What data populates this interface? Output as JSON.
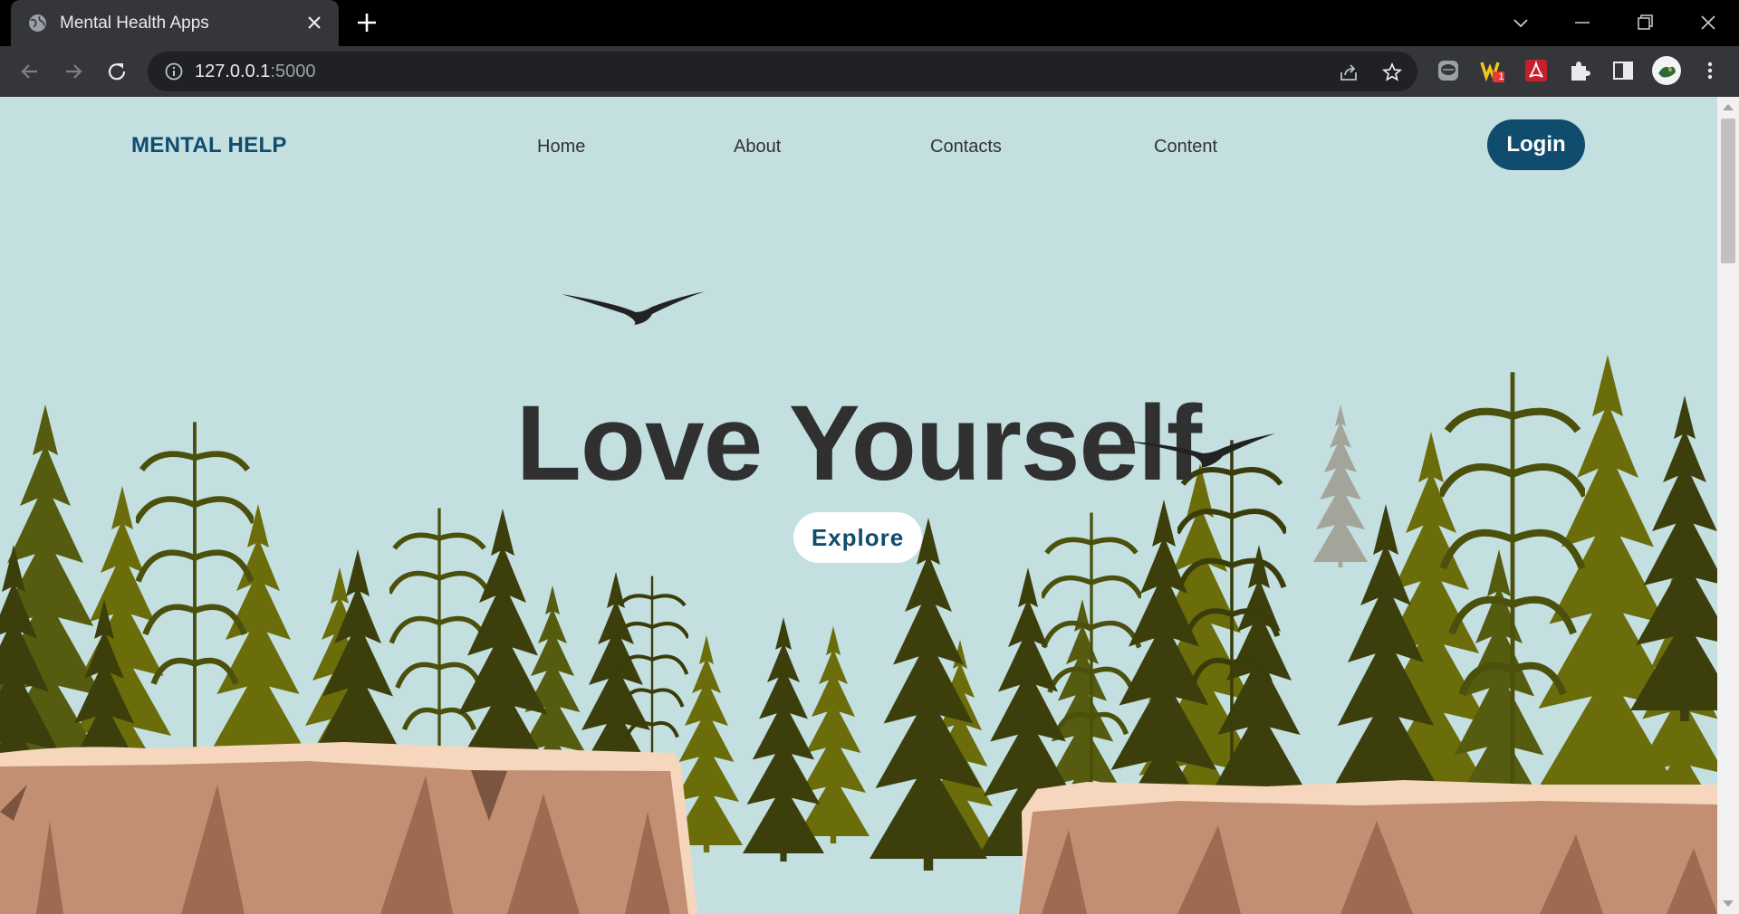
{
  "browser": {
    "tab_title": "Mental Health Apps",
    "url_host": "127.0.0.1",
    "url_port": ":5000",
    "extension_badge": "1"
  },
  "site": {
    "brand": "MENTAL HELP",
    "nav": [
      {
        "label": "Home"
      },
      {
        "label": "About"
      },
      {
        "label": "Contacts"
      },
      {
        "label": "Content"
      }
    ],
    "login_label": "Login",
    "hero_title": "Love Yourself",
    "explore_label": "Explore"
  },
  "colors": {
    "sky": "#c4dfe0",
    "brand_blue": "#0f4c6e",
    "forest_dark": "#3c3f0c",
    "forest_mid": "#525a10",
    "forest_light": "#6c6e0a",
    "cliff": "#c28f72"
  },
  "icons": {
    "favicon": "globe-icon",
    "back": "arrow-left-icon",
    "forward": "arrow-right-icon",
    "reload": "reload-icon",
    "site_info": "info-icon",
    "share": "share-icon",
    "bookmark": "star-icon",
    "extensions": [
      "line-extension-icon",
      "wappalyzer-icon",
      "acrobat-icon",
      "puzzle-icon"
    ],
    "side_panel": "side-panel-icon",
    "profile": "avatar",
    "menu": "kebab-menu-icon"
  }
}
